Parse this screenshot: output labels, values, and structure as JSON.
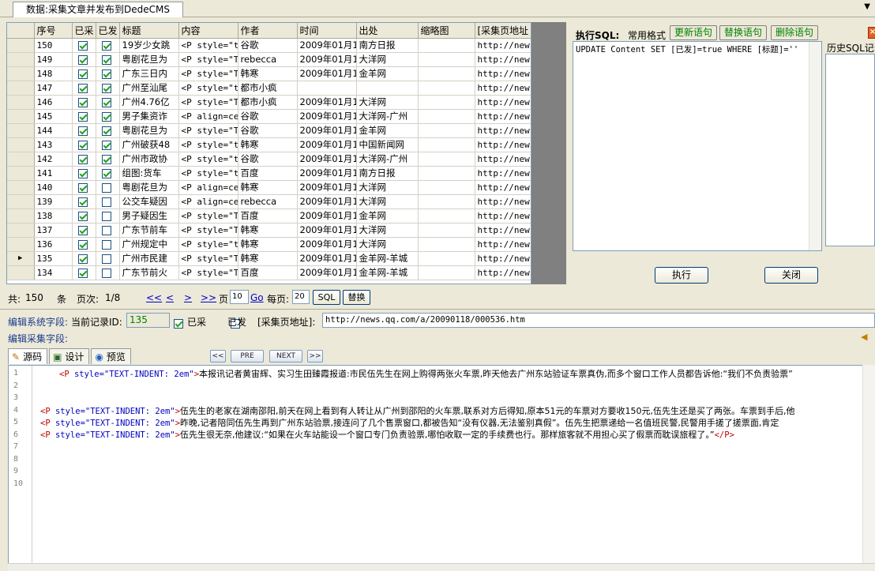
{
  "window": {
    "tab_title": "数据:采集文章并发布到DedeCMS"
  },
  "grid": {
    "columns": [
      "序号",
      "已采",
      "已发",
      "标题",
      "内容",
      "作者",
      "时间",
      "出处",
      "缩略图",
      "[采集页地址"
    ],
    "rows": [
      {
        "id": "150",
        "cai": true,
        "fa": true,
        "title": "19岁少女跳",
        "content": "<P style=\"t",
        "author": "谷歌",
        "time": "2009年01月1",
        "source": "南方日报",
        "thumb": "",
        "url": "http://news"
      },
      {
        "id": "149",
        "cai": true,
        "fa": true,
        "title": "粤剧花旦为",
        "content": "<P style=\"T",
        "author": "rebecca",
        "time": "2009年01月1",
        "source": "大洋网",
        "thumb": "",
        "url": "http://news"
      },
      {
        "id": "148",
        "cai": true,
        "fa": true,
        "title": "广东三日内",
        "content": "<P style=\"T",
        "author": "韩寒",
        "time": "2009年01月1",
        "source": "金羊网",
        "thumb": "",
        "url": "http://news"
      },
      {
        "id": "147",
        "cai": true,
        "fa": true,
        "title": "广州至汕尾",
        "content": "<P style=\"t",
        "author": "都市小疯",
        "time": "",
        "source": "",
        "thumb": "",
        "url": "http://news"
      },
      {
        "id": "146",
        "cai": true,
        "fa": true,
        "title": "广州4.76亿",
        "content": "<P style=\"T",
        "author": "都市小疯",
        "time": "2009年01月1",
        "source": "大洋网",
        "thumb": "",
        "url": "http://news"
      },
      {
        "id": "145",
        "cai": true,
        "fa": true,
        "title": "男子集资诈",
        "content": "<P align=ce",
        "author": "谷歌",
        "time": "2009年01月1",
        "source": "大洋网-广州",
        "thumb": "",
        "url": "http://news"
      },
      {
        "id": "144",
        "cai": true,
        "fa": true,
        "title": "粤剧花旦为",
        "content": "<P style=\"T",
        "author": "谷歌",
        "time": "2009年01月1",
        "source": "金羊网",
        "thumb": "",
        "url": "http://news"
      },
      {
        "id": "143",
        "cai": true,
        "fa": true,
        "title": "广州破获48",
        "content": "<P style=\"t",
        "author": "韩寒",
        "time": "2009年01月1",
        "source": "中国新闻网",
        "thumb": "",
        "url": "http://news"
      },
      {
        "id": "142",
        "cai": true,
        "fa": true,
        "title": "广州市政协",
        "content": "<P style=\"t",
        "author": "谷歌",
        "time": "2009年01月1",
        "source": "大洋网-广州",
        "thumb": "",
        "url": "http://news"
      },
      {
        "id": "141",
        "cai": true,
        "fa": true,
        "title": "组图:货车",
        "content": "<P style=\"t",
        "author": "百度",
        "time": "2009年01月1",
        "source": "南方日报",
        "thumb": "",
        "url": "http://news"
      },
      {
        "id": "140",
        "cai": true,
        "fa": false,
        "title": "粤剧花旦为",
        "content": "<P align=ce",
        "author": "韩寒",
        "time": "2009年01月1",
        "source": "大洋网",
        "thumb": "",
        "url": "http://news"
      },
      {
        "id": "139",
        "cai": true,
        "fa": false,
        "title": "公交车疑因",
        "content": "<P align=ce",
        "author": "rebecca",
        "time": "2009年01月1",
        "source": "大洋网",
        "thumb": "",
        "url": "http://news"
      },
      {
        "id": "138",
        "cai": true,
        "fa": false,
        "title": "男子疑因生",
        "content": "<P style=\"T",
        "author": "百度",
        "time": "2009年01月1",
        "source": "金羊网",
        "thumb": "",
        "url": "http://news"
      },
      {
        "id": "137",
        "cai": true,
        "fa": false,
        "title": "广东节前车",
        "content": "<P style=\"T",
        "author": "韩寒",
        "time": "2009年01月1",
        "source": "大洋网",
        "thumb": "",
        "url": "http://news"
      },
      {
        "id": "136",
        "cai": true,
        "fa": false,
        "title": "广州规定中",
        "content": "<P style=\"t",
        "author": "韩寒",
        "time": "2009年01月1",
        "source": "大洋网",
        "thumb": "",
        "url": "http://news"
      },
      {
        "id": "135",
        "cai": true,
        "fa": false,
        "title": "广州市民建",
        "content": "<P style=\"T",
        "author": "韩寒",
        "time": "2009年01月1",
        "source": "金羊网-羊城",
        "thumb": "",
        "url": "http://news",
        "current": true
      },
      {
        "id": "134",
        "cai": true,
        "fa": false,
        "title": "广东节前火",
        "content": "<P style=\"T",
        "author": "百度",
        "time": "2009年01月1",
        "source": "金羊网-羊城",
        "thumb": "",
        "url": "http://news"
      }
    ]
  },
  "sql": {
    "label": "执行SQL:",
    "format_label": "常用格式",
    "update_btn": "更新语句",
    "replace_btn": "替换语句",
    "delete_btn": "删除语句",
    "text": "UPDATE Content SET [已发]=true WHERE [标题]=''",
    "history_label": "历史SQL记录",
    "exec_btn": "执行",
    "close_btn": "关闭"
  },
  "pager": {
    "total_label": "共:",
    "total": "150",
    "unit": "条",
    "page_label": "页次:",
    "page": "1/8",
    "first": "<<",
    "prev": "<",
    "next": ">",
    "last": ">>",
    "goto_label": "页",
    "goto_value": "10",
    "go": "Go",
    "per_page_label": "每页:",
    "per_page_value": "20",
    "sql_btn": "SQL",
    "replace_btn": "替换"
  },
  "system_fields": {
    "label": "编辑系统字段:",
    "record_id_label": "当前记录ID:",
    "record_id": "135",
    "cai_label": "已采",
    "cai": true,
    "fa_label": "已发",
    "fa": false,
    "url_label": "[采集页地址]:",
    "url_value": "http://news.qq.com/a/20090118/000536.htm"
  },
  "collect_fields": {
    "label": "编辑采集字段:"
  },
  "editor": {
    "tabs": [
      "源码",
      "设计",
      "预览"
    ],
    "nav": [
      "<<",
      "PRE",
      "NEXT",
      ">>"
    ],
    "line_numbers": [
      "1",
      "2",
      "3",
      "4",
      "5",
      "6",
      "7",
      "8",
      "9",
      "10"
    ],
    "lines": [
      {
        "tag": "<P ",
        "attr": "style=\"TEXT-INDENT: 2em\"",
        "close": ">",
        "text": "本报讯记者黄宙辉、实习生田臻霞报道:市民伍先生在网上购得两张火车票,昨天他去广州东站验证车票真伪,而多个窗口工作人员都告诉他:“我们不负责验票”",
        "indent": false
      },
      {
        "tag": "<P ",
        "attr": "style=\"TEXT-INDENT: 2em\"",
        "close": ">",
        "text": "伍先生的老家在湖南邵阳,前天在网上看到有人转让从广州到邵阳的火车票,联系对方后得知,原本51元的车票对方要收150元,伍先生还是买了两张。车票到手后,他",
        "indent": true
      },
      {
        "tag": "<P ",
        "attr": "style=\"TEXT-INDENT: 2em\"",
        "close": ">",
        "text": "昨晚,记者陪同伍先生再到广州东站验票,接连问了几个售票窗口,都被告知“没有仪器,无法鉴别真假”。伍先生把票递给一名值班民警,民警用手搓了搓票面,肯定",
        "indent": true
      },
      {
        "tag": "<P ",
        "attr": "style=\"TEXT-INDENT: 2em\"",
        "close": ">",
        "text": "伍先生很无奈,他建议:“如果在火车站能设一个窗口专门负责验票,哪怕收取一定的手续费也行。那样旅客就不用担心买了假票而耽误旅程了。”",
        "end": "</P>",
        "indent": true
      }
    ]
  }
}
